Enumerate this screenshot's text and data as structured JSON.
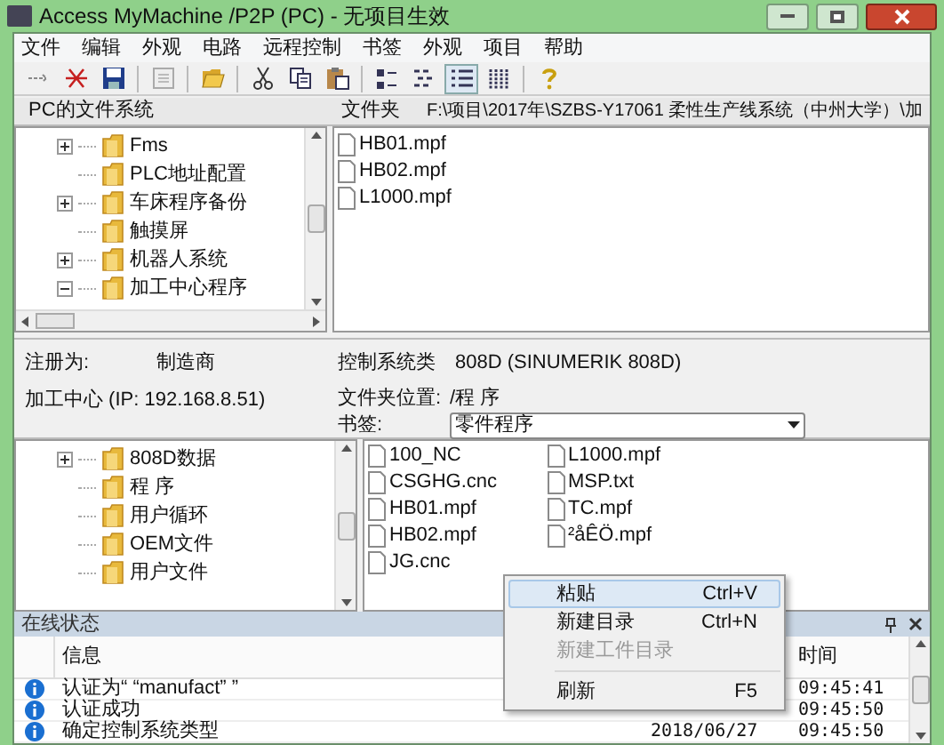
{
  "window": {
    "title": "Access MyMachine /P2P (PC) - 无项目生效"
  },
  "menu": [
    "文件",
    "编辑",
    "外观",
    "电路",
    "远程控制",
    "书签",
    "外观",
    "项目",
    "帮助"
  ],
  "toolbar": [
    {
      "kind": "connect"
    },
    {
      "kind": "disconnect"
    },
    {
      "kind": "save"
    },
    {
      "kind": "separator"
    },
    {
      "kind": "properties"
    },
    {
      "kind": "separator"
    },
    {
      "kind": "open"
    },
    {
      "kind": "separator"
    },
    {
      "kind": "cut"
    },
    {
      "kind": "copy"
    },
    {
      "kind": "paste"
    },
    {
      "kind": "separator"
    },
    {
      "kind": "large_icons",
      "pressed": false
    },
    {
      "kind": "small_icons",
      "pressed": false
    },
    {
      "kind": "list",
      "pressed": true
    },
    {
      "kind": "details",
      "pressed": false
    },
    {
      "kind": "separator"
    },
    {
      "kind": "help"
    }
  ],
  "pc_panel": {
    "title": "PC的文件系统",
    "folder_label": "文件夹",
    "folder_path": "F:\\项目\\2017年\\SZBS-Y17061 柔性生产线系统（中州大学）\\加",
    "tree": [
      {
        "label": "Fms",
        "expanded": false
      },
      {
        "label": "PLC地址配置"
      },
      {
        "label": "车床程序备份",
        "expanded": false
      },
      {
        "label": "触摸屏"
      },
      {
        "label": "机器人系统",
        "expanded": false
      },
      {
        "label": "加工中心程序",
        "expanded": true
      }
    ],
    "files": [
      "HB01.mpf",
      "HB02.mpf",
      "L1000.mpf"
    ]
  },
  "info": {
    "registered_label": "注册为:",
    "registered_value": "制造商",
    "machine": "加工中心 (IP: 192.168.8.51)",
    "control_label": "控制系统类",
    "control_value": "808D (SINUMERIK 808D)",
    "location_label": "文件夹位置:",
    "location_value": "/程 序",
    "bookmark_label": "书签:",
    "bookmark_value": "零件程序"
  },
  "nc_panel": {
    "tree": [
      {
        "label": "808D数据",
        "expanded": false
      },
      {
        "label": "程 序"
      },
      {
        "label": "用户循环"
      },
      {
        "label": "OEM文件"
      },
      {
        "label": "用户文件"
      }
    ],
    "files": [
      "100_NC",
      "CSGHG.cnc",
      "HB01.mpf",
      "HB02.mpf",
      "JG.cnc",
      "L1000.mpf",
      "MSP.txt",
      "TC.mpf",
      "²åÊÖ.mpf"
    ]
  },
  "status_pane": {
    "title": "在线状态",
    "columns": [
      "信息",
      "时间"
    ],
    "rows": [
      {
        "message": "认证为“ “manufact” ”",
        "time": "09:45:41"
      },
      {
        "message": "认证成功",
        "time": "09:45:50"
      },
      {
        "message": "确定控制系统类型",
        "date": "2018/06/27",
        "time": "09:45:50"
      }
    ]
  },
  "context_menu": [
    {
      "kind": "item",
      "label": "粘贴",
      "shortcut": "Ctrl+V",
      "selected": true,
      "disabled": false
    },
    {
      "kind": "item",
      "label": "新建目录",
      "shortcut": "Ctrl+N",
      "selected": false,
      "disabled": false
    },
    {
      "kind": "item",
      "label": "新建工件目录",
      "selected": false,
      "disabled": true
    },
    {
      "kind": "separator"
    },
    {
      "kind": "item",
      "label": "刷新",
      "shortcut": "F5",
      "selected": false,
      "disabled": false
    }
  ]
}
